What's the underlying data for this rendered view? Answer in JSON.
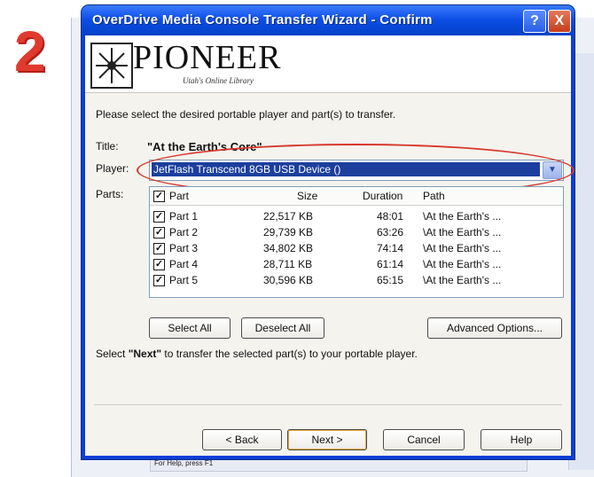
{
  "step_number": "2",
  "background": {
    "status_text": "For Help, press F1"
  },
  "window": {
    "title": "OverDrive Media Console Transfer Wizard - Confirm",
    "help_button": "?",
    "close_button": "X"
  },
  "banner": {
    "logo_name": "PIONEER",
    "logo_tagline": "Utah's Online Library"
  },
  "instruction": "Please select the desired portable player and part(s) to transfer.",
  "title_label": "Title:",
  "title_value": "\"At the Earth's Core\"",
  "player_label": "Player:",
  "player_value": "JetFlash Transcend 8GB USB Device ()",
  "dropdown_arrow": "▼",
  "parts_label": "Parts:",
  "parts": {
    "headers": {
      "part": "Part",
      "size": "Size",
      "duration": "Duration",
      "path": "Path"
    },
    "check_mark": "✓",
    "rows": [
      {
        "part": "Part 1",
        "size": "22,517 KB",
        "duration": "48:01",
        "path": "\\At the Earth's ..."
      },
      {
        "part": "Part 2",
        "size": "29,739 KB",
        "duration": "63:26",
        "path": "\\At the Earth's ..."
      },
      {
        "part": "Part 3",
        "size": "34,802 KB",
        "duration": "74:14",
        "path": "\\At the Earth's ..."
      },
      {
        "part": "Part 4",
        "size": "28,711 KB",
        "duration": "61:14",
        "path": "\\At the Earth's ..."
      },
      {
        "part": "Part 5",
        "size": "30,596 KB",
        "duration": "65:15",
        "path": "\\At the Earth's ..."
      }
    ]
  },
  "buttons": {
    "select_all": "Select All",
    "deselect_all": "Deselect All",
    "advanced_options": "Advanced Options...",
    "back": "< Back",
    "next": "Next >",
    "cancel": "Cancel",
    "help": "Help"
  },
  "next_hint": {
    "prefix": "Select ",
    "emphasis": "\"Next\"",
    "suffix": " to transfer the selected part(s) to your portable player."
  },
  "colors": {
    "titlebar": "#0b4ce3",
    "highlight": "#d7382d",
    "step_number": "#e0392e",
    "selection": "#1c3f9e"
  }
}
